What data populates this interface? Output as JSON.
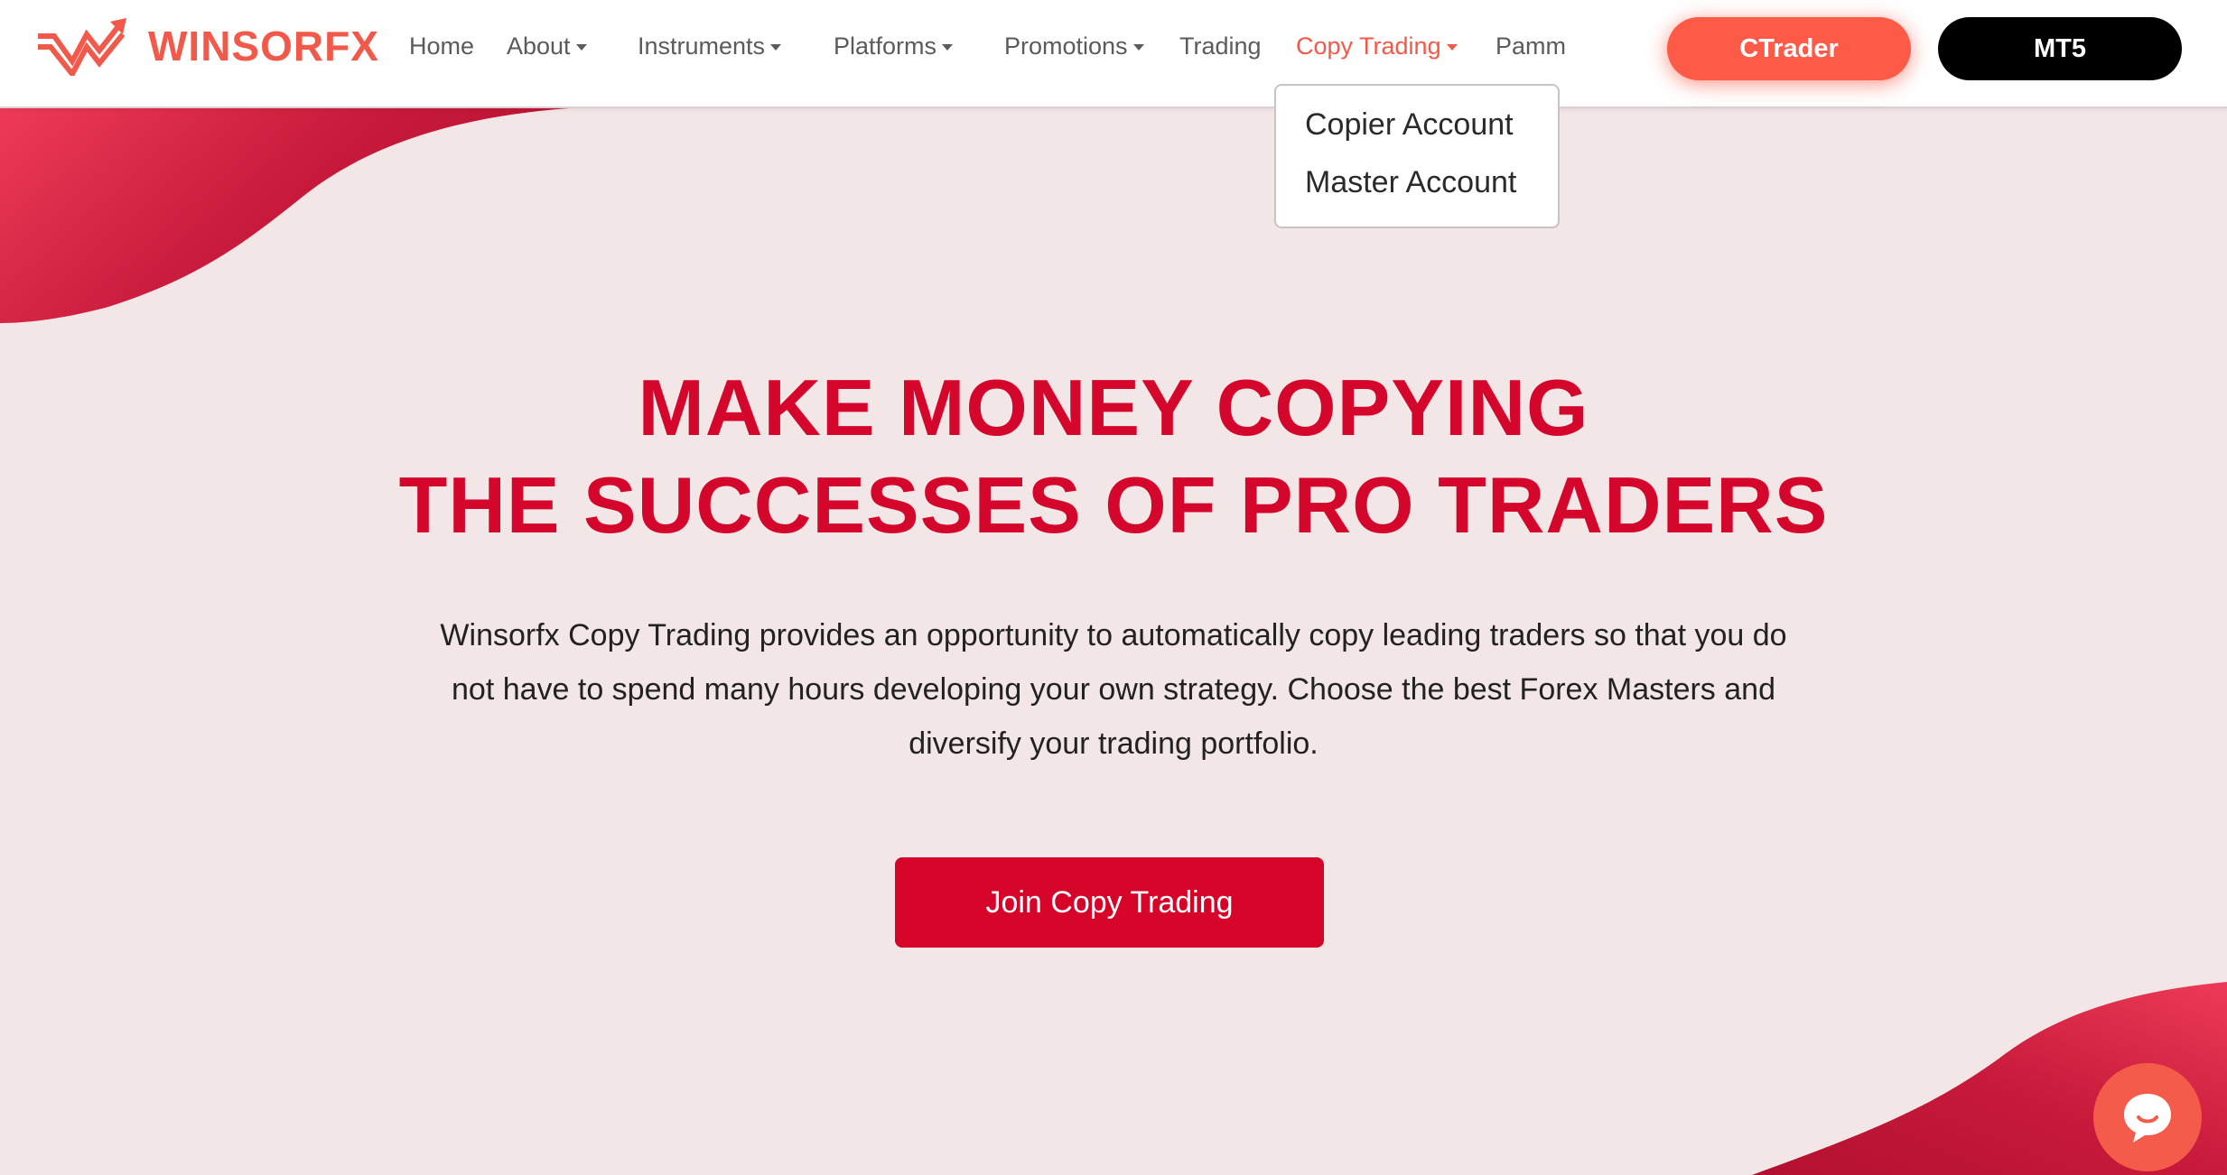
{
  "brand": {
    "name": "WINSORFX",
    "color": "#f15a4a"
  },
  "nav": {
    "home": "Home",
    "about": "About",
    "instruments": "Instruments",
    "platforms": "Platforms",
    "promotions": "Promotions",
    "trading": "Trading",
    "copy_trading": "Copy Trading",
    "pamm": "Pamm"
  },
  "buttons": {
    "ctrader": "CTrader",
    "mt5": "MT5",
    "join": "Join Copy Trading"
  },
  "dropdown": {
    "items": [
      "Copier Account",
      "Master Account"
    ]
  },
  "hero": {
    "title_line1": "MAKE MONEY COPYING",
    "title_line2": "THE SUCCESSES OF PRO TRADERS",
    "description": "Winsorfx Copy Trading provides an opportunity to automatically copy leading traders so that you do not have to spend many hours developing your own strategy. Choose the best Forex Masters and diversify your trading portfolio."
  },
  "icons": {
    "logo": "winsorfx-logo-icon",
    "chat": "chat-icon"
  },
  "colors": {
    "accent": "#f15a4a",
    "title_red": "#d4062c",
    "join_button": "#d7042a",
    "background": "#f3e6e6"
  }
}
